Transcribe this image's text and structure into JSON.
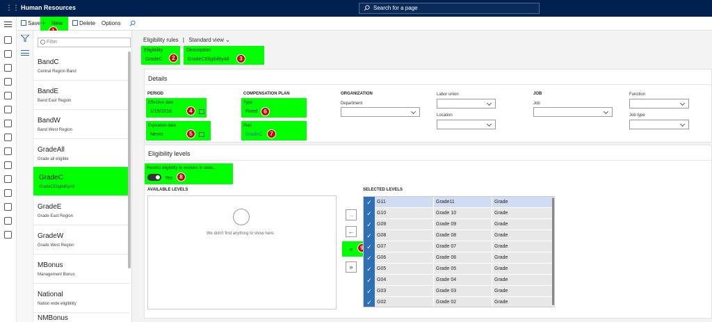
{
  "app": {
    "title": "Human Resources"
  },
  "search": {
    "placeholder": "Search for a page"
  },
  "toolbar": {
    "save": "Save",
    "new": "New",
    "delete": "Delete",
    "options": "Options"
  },
  "filter": {
    "placeholder": "Filter"
  },
  "list": [
    {
      "title": "BandC",
      "sub": "Central Region Band"
    },
    {
      "title": "BandE",
      "sub": "Band East Region"
    },
    {
      "title": "BandW",
      "sub": "Band West Region"
    },
    {
      "title": "GradeAll",
      "sub": "Grade all eligible"
    },
    {
      "title": "GradeC",
      "sub": "GradeCEligibilityAll"
    },
    {
      "title": "GradeE",
      "sub": "Grade East Region"
    },
    {
      "title": "GradeW",
      "sub": "Grade West Region"
    },
    {
      "title": "MBonus",
      "sub": "Management Bonus"
    },
    {
      "title": "National",
      "sub": "Nation wide eligibility"
    },
    {
      "title": "NMBonus",
      "sub": ""
    }
  ],
  "breadcrumb": {
    "page": "Eligibility rules",
    "sep": "|",
    "view": "Standard view"
  },
  "header": {
    "eligibility_label": "Eligibility",
    "eligibility_value": "GradeC",
    "description_label": "Description",
    "description_value": "GradeCEligibilityAll"
  },
  "details": {
    "title": "Details",
    "period": "PERIOD",
    "effective_label": "Effective date",
    "effective_value": "1/15/2016",
    "expiration_label": "Expiration date",
    "expiration_value": "Never",
    "comp_plan": "COMPENSATION PLAN",
    "type_label": "Type",
    "type_value": "Fixed",
    "plan_label": "Plan",
    "plan_value": "GradeC",
    "organization": "ORGANIZATION",
    "department_label": "Department",
    "labor_union_label": "Labor union",
    "location_label": "Location",
    "job_head": "JOB",
    "job_label": "Job",
    "function_label": "Function",
    "job_type_label": "Job type"
  },
  "levels": {
    "title": "Eligibility levels",
    "restrict_label": "Restrict eligibility to workers in selec...",
    "restrict_value": "Yes",
    "available": "AVAILABLE LEVELS",
    "empty": "We didn't find anything to show here.",
    "selected": "SELECTED LEVELS",
    "rows": [
      {
        "code": "G11",
        "name": "Grade11",
        "type": "Grade"
      },
      {
        "code": "G10",
        "name": "Grade 10",
        "type": "Grade"
      },
      {
        "code": "G09",
        "name": "Grade 09",
        "type": "Grade"
      },
      {
        "code": "G08",
        "name": "Grade 08",
        "type": "Grade"
      },
      {
        "code": "G07",
        "name": "Grade 07",
        "type": "Grade"
      },
      {
        "code": "G06",
        "name": "Grade 06",
        "type": "Grade"
      },
      {
        "code": "G05",
        "name": "Grade 05",
        "type": "Grade"
      },
      {
        "code": "G04",
        "name": "Grade 04",
        "type": "Grade"
      },
      {
        "code": "G03",
        "name": "Grade 03",
        "type": "Grade"
      },
      {
        "code": "G02",
        "name": "Grade 02",
        "type": "Grade"
      }
    ]
  },
  "badges": [
    "1",
    "2",
    "3",
    "4",
    "5",
    "6",
    "7",
    "8",
    "9"
  ],
  "colors": {
    "highlight": "#00ff00",
    "badge": "#cc0000",
    "topbar": "#002050",
    "check": "#2f6fb6"
  }
}
